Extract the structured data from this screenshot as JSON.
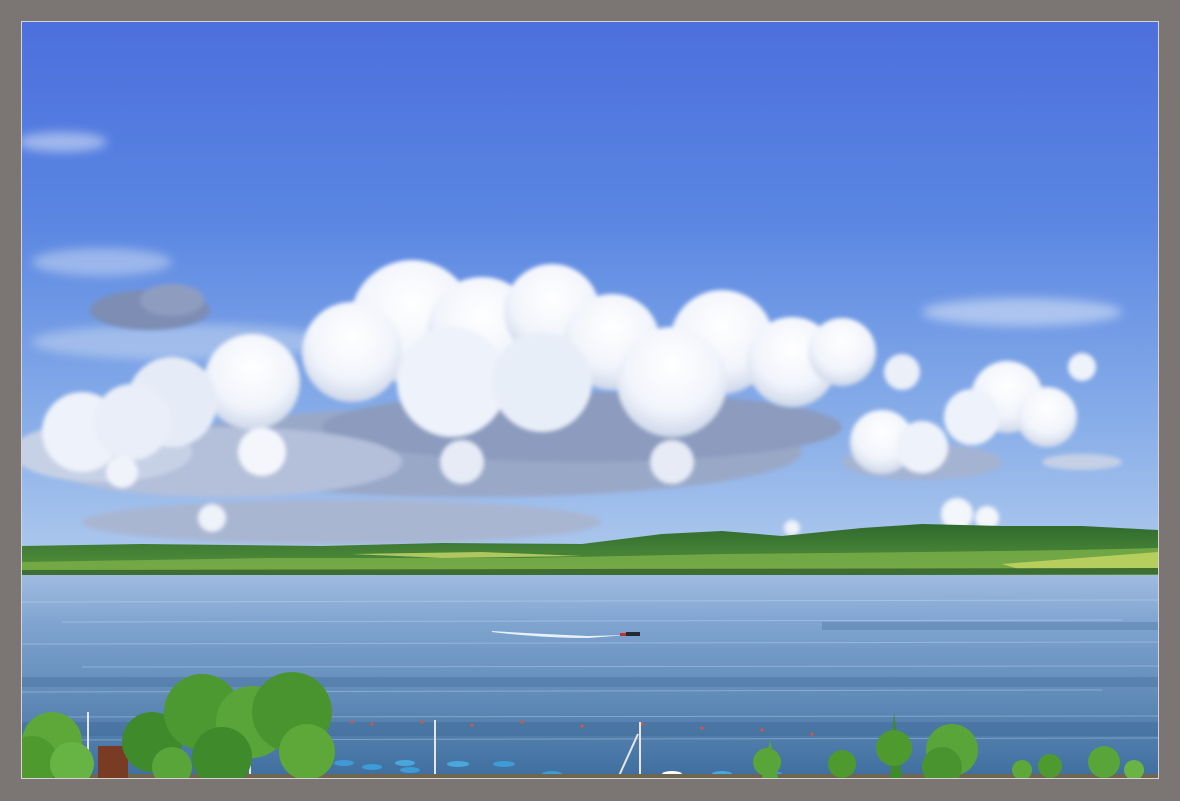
{
  "photo": {
    "subject": "lake-landscape",
    "elements": [
      "sky",
      "cumulus-clouds",
      "green-hills",
      "lake",
      "speedboat",
      "beach-umbrellas",
      "trees"
    ]
  },
  "colors": {
    "frame": "#7b7574",
    "sky_top": "#4f74e0",
    "sky_horizon": "#a9c6ec",
    "cloud": "#ffffff",
    "cloud_shadow": "#8e9fc4",
    "hills": "#3f7d3a",
    "field_light": "#b7d25a",
    "water": "#5b8ab9",
    "trees": "#4f9a2e"
  }
}
